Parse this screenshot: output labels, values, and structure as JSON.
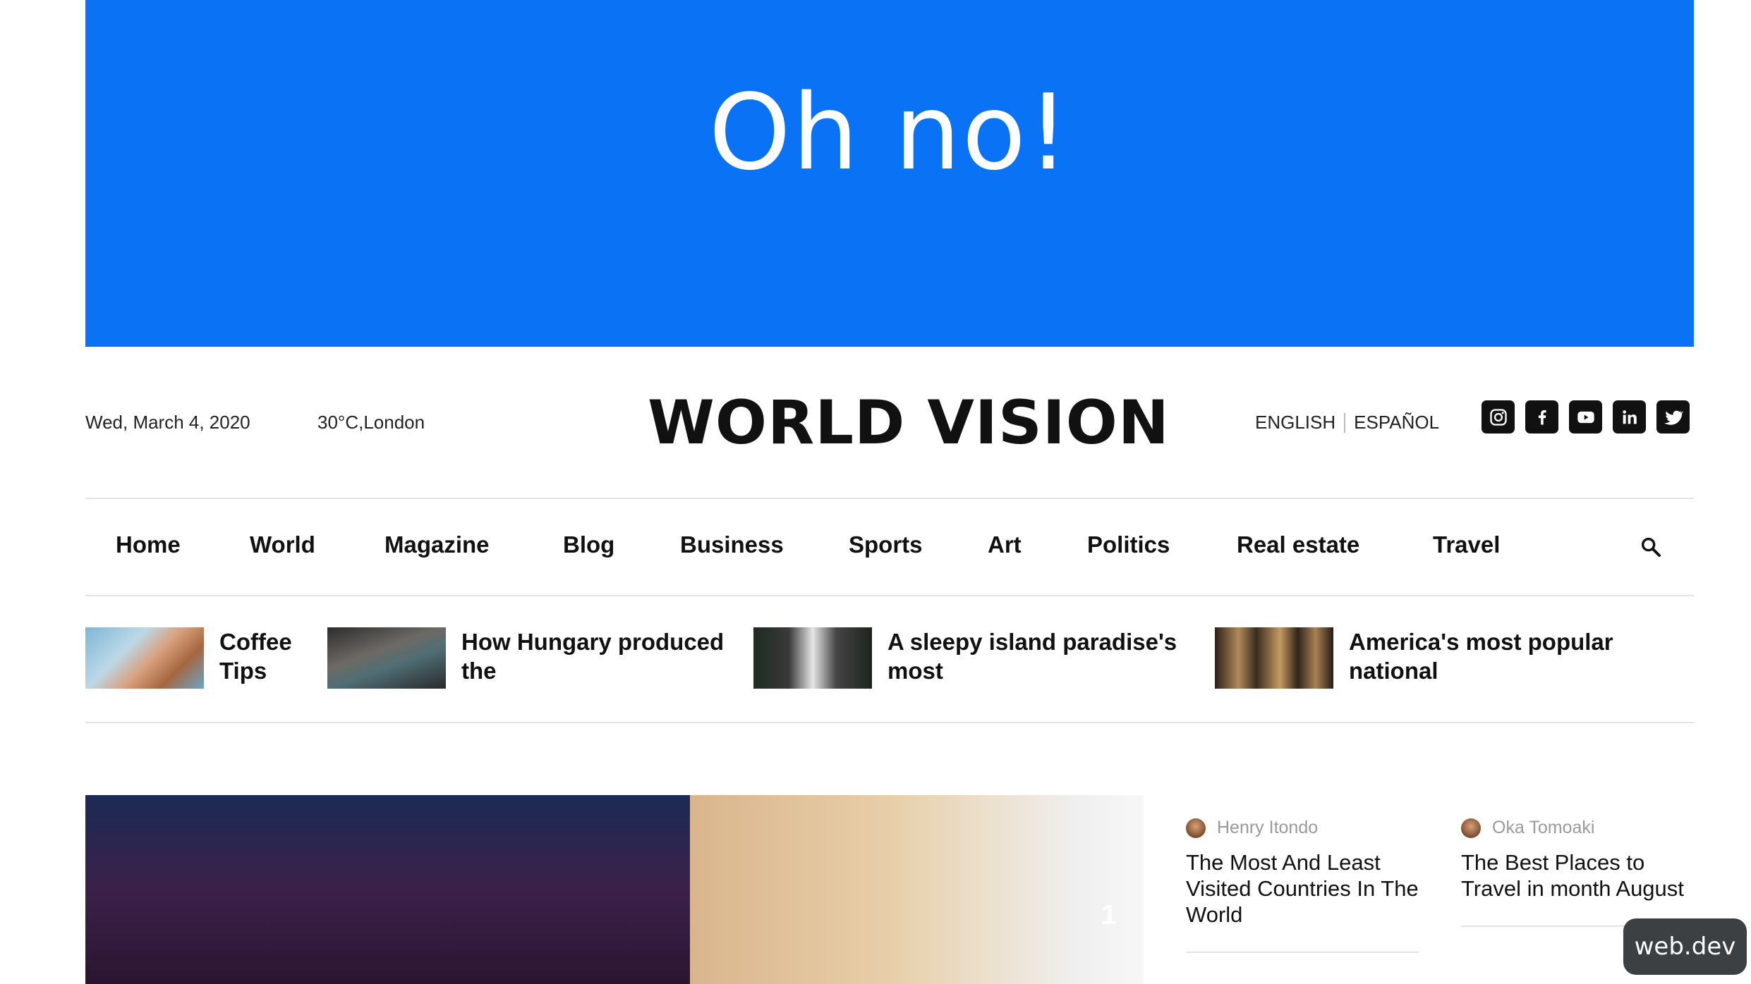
{
  "banner": {
    "text": "Oh no!",
    "color": "#0a73f5"
  },
  "header": {
    "date": "Wed, March 4, 2020",
    "weather": "30°C,London",
    "logo": "WORLD VISION",
    "languages": [
      "ENGLISH",
      "ESPAÑOL"
    ],
    "social": [
      "instagram-icon",
      "facebook-icon",
      "youtube-icon",
      "linkedin-icon",
      "twitter-icon"
    ]
  },
  "nav": {
    "items": [
      "Home",
      "World",
      "Magazine",
      "Blog",
      "Business",
      "Sports",
      "Art",
      "Politics",
      "Real estate",
      "Travel"
    ],
    "search_icon": "search-icon"
  },
  "trending": [
    {
      "title_line1": "Coffee",
      "title_line2": "Tips"
    },
    {
      "title_line1": "How Hungary produced",
      "title_line2": "the"
    },
    {
      "title_line1": "A sleepy island paradise's",
      "title_line2": "most"
    },
    {
      "title_line1": "America's most popular",
      "title_line2": "national"
    }
  ],
  "hero": {
    "slide_number": "1"
  },
  "side_articles": [
    {
      "author": "Henry Itondo",
      "title": "The Most And Least Visited Countries In The World"
    },
    {
      "author": "Oka Tomoaki",
      "title": "The Best Places to Travel in month August"
    }
  ],
  "badge": {
    "text": "web.dev"
  }
}
